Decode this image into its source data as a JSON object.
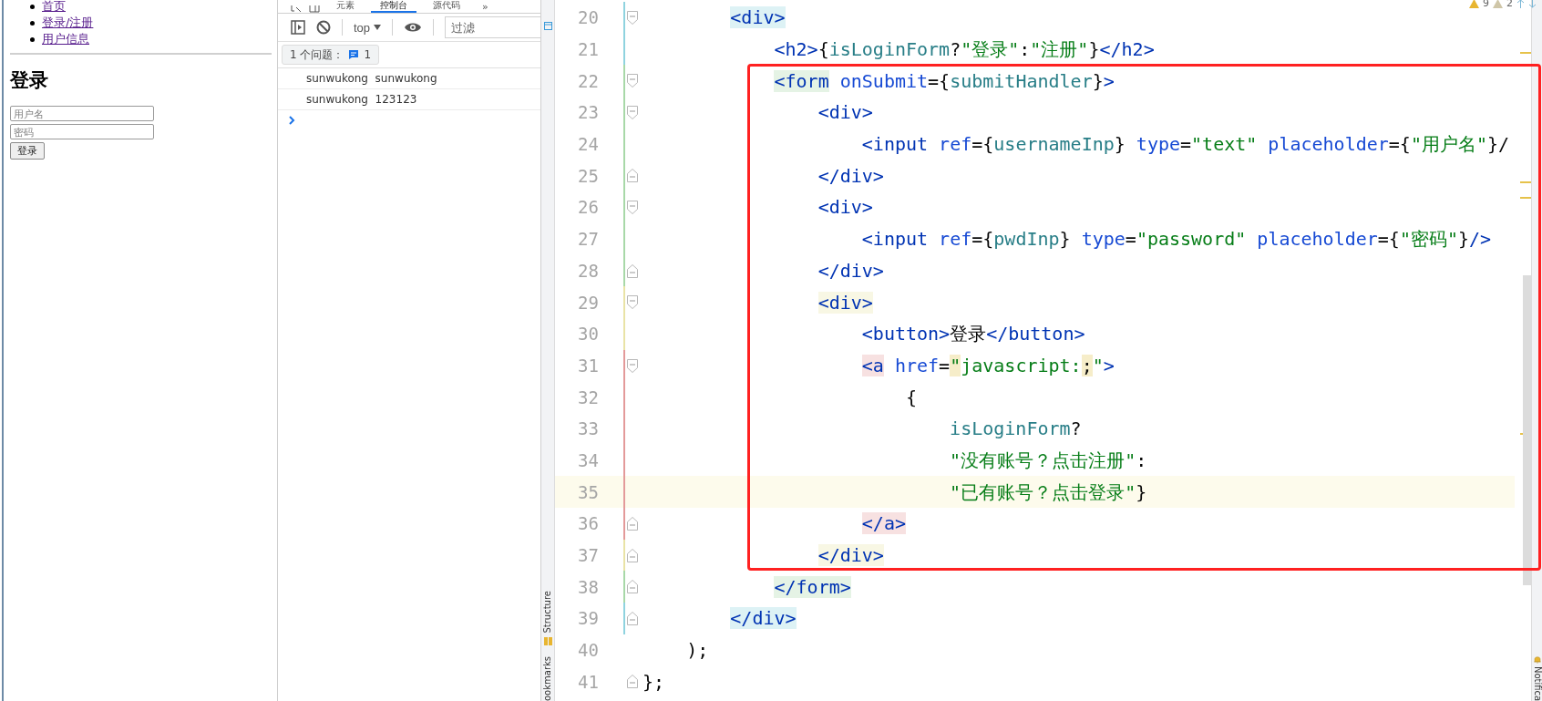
{
  "browser_page": {
    "nav_links": [
      {
        "label": "首页"
      },
      {
        "label": "登录/注册"
      },
      {
        "label": "用户信息"
      }
    ],
    "heading": "登录",
    "fields": [
      {
        "placeholder": "用户名"
      },
      {
        "placeholder": "密码"
      }
    ],
    "submit_button": "登录"
  },
  "devtools": {
    "tabs": [
      {
        "label": "元素",
        "selected": false
      },
      {
        "label": "控制台",
        "selected": true
      },
      {
        "label": "源代码",
        "selected": false
      }
    ],
    "more_tabs": "»",
    "context": "top",
    "filter": {
      "placeholder": "过滤"
    },
    "issues": {
      "label": "1 个问题：",
      "count": "1"
    },
    "console_messages": [
      "sunwukong  sunwukong",
      "sunwukong  123123"
    ]
  },
  "editor": {
    "inspections": {
      "warnings": "9",
      "weak_warnings": "2"
    },
    "left_tools": [
      "Structure",
      "ookmarks"
    ],
    "right_tools": [
      "Notifica"
    ],
    "lines": [
      {
        "number": "20",
        "fold_start": true,
        "fold_end": false,
        "color": "#8fd3df",
        "current": false,
        "tokens": [
          {
            "text": "        <div>",
            "kind": "tag",
            "matched": true
          }
        ]
      },
      {
        "number": "21",
        "fold_start": false,
        "fold_end": false,
        "color": "#8fd3df",
        "current": false,
        "tokens": [
          {
            "text": "            <h2>",
            "kind": "tag"
          },
          {
            "text": "{",
            "kind": "plain"
          },
          {
            "text": "isLoginForm",
            "kind": "ident"
          },
          {
            "text": "?",
            "kind": "plain"
          },
          {
            "text": "\"登录\"",
            "kind": "string"
          },
          {
            "text": ":",
            "kind": "plain"
          },
          {
            "text": "\"注册\"",
            "kind": "string"
          },
          {
            "text": "}",
            "kind": "plain"
          },
          {
            "text": "</h2>",
            "kind": "tag"
          }
        ]
      },
      {
        "number": "22",
        "fold_start": true,
        "fold_end": false,
        "color": "#a8d8a8",
        "current": false,
        "tokens": [
          {
            "text": "            <form",
            "kind": "tag",
            "matched": true
          },
          {
            "text": " onSubmit",
            "kind": "attr"
          },
          {
            "text": "={",
            "kind": "plain"
          },
          {
            "text": "submitHandler",
            "kind": "ident"
          },
          {
            "text": "}",
            "kind": "plain"
          },
          {
            "text": ">",
            "kind": "tag"
          }
        ]
      },
      {
        "number": "23",
        "fold_start": true,
        "fold_end": false,
        "color": "#a8d8a8",
        "current": false,
        "tokens": [
          {
            "text": "                <div>",
            "kind": "tag"
          }
        ]
      },
      {
        "number": "24",
        "fold_start": false,
        "fold_end": false,
        "color": "#a8d8a8",
        "current": false,
        "tokens": [
          {
            "text": "                    <input",
            "kind": "tag"
          },
          {
            "text": " ref",
            "kind": "attr"
          },
          {
            "text": "={",
            "kind": "plain"
          },
          {
            "text": "usernameInp",
            "kind": "ident"
          },
          {
            "text": "}",
            "kind": "plain"
          },
          {
            "text": " type",
            "kind": "attr"
          },
          {
            "text": "=",
            "kind": "plain"
          },
          {
            "text": "\"text\"",
            "kind": "string"
          },
          {
            "text": " placeholder",
            "kind": "attr"
          },
          {
            "text": "={",
            "kind": "plain"
          },
          {
            "text": "\"用户名\"",
            "kind": "string"
          },
          {
            "text": "}/",
            "kind": "plain"
          }
        ]
      },
      {
        "number": "25",
        "fold_start": false,
        "fold_end": true,
        "color": "#a8d8a8",
        "current": false,
        "tokens": [
          {
            "text": "                </div>",
            "kind": "tag"
          }
        ]
      },
      {
        "number": "26",
        "fold_start": true,
        "fold_end": false,
        "color": "#a8d8a8",
        "current": false,
        "tokens": [
          {
            "text": "                <div>",
            "kind": "tag"
          }
        ]
      },
      {
        "number": "27",
        "fold_start": false,
        "fold_end": false,
        "color": "#a8d8a8",
        "current": false,
        "tokens": [
          {
            "text": "                    <input",
            "kind": "tag"
          },
          {
            "text": " ref",
            "kind": "attr"
          },
          {
            "text": "={",
            "kind": "plain"
          },
          {
            "text": "pwdInp",
            "kind": "ident"
          },
          {
            "text": "}",
            "kind": "plain"
          },
          {
            "text": " type",
            "kind": "attr"
          },
          {
            "text": "=",
            "kind": "plain"
          },
          {
            "text": "\"password\"",
            "kind": "string"
          },
          {
            "text": " placeholder",
            "kind": "attr"
          },
          {
            "text": "={",
            "kind": "plain"
          },
          {
            "text": "\"密码\"",
            "kind": "string"
          },
          {
            "text": "}",
            "kind": "plain"
          },
          {
            "text": "/>",
            "kind": "tag"
          }
        ]
      },
      {
        "number": "28",
        "fold_start": false,
        "fold_end": true,
        "color": "#a8d8a8",
        "current": false,
        "tokens": [
          {
            "text": "                </div>",
            "kind": "tag"
          }
        ]
      },
      {
        "number": "29",
        "fold_start": true,
        "fold_end": false,
        "color": "#e9e3a6",
        "current": false,
        "tokens": [
          {
            "text": "                <div>",
            "kind": "tag",
            "matched": true
          }
        ]
      },
      {
        "number": "30",
        "fold_start": false,
        "fold_end": false,
        "color": "#e9e3a6",
        "current": false,
        "tokens": [
          {
            "text": "                    <button>",
            "kind": "tag"
          },
          {
            "text": "登录",
            "kind": "plain"
          },
          {
            "text": "</button>",
            "kind": "tag"
          }
        ]
      },
      {
        "number": "31",
        "fold_start": true,
        "fold_end": false,
        "color": "#e39a9a",
        "current": false,
        "tokens": [
          {
            "text": "                    <a",
            "kind": "tag",
            "matched": true
          },
          {
            "text": " href",
            "kind": "attr"
          },
          {
            "text": "=",
            "kind": "plain"
          },
          {
            "text": "\"",
            "kind": "string_paired"
          },
          {
            "text": "javascript:",
            "kind": "string"
          },
          {
            "text": ";",
            "kind": "plain_paired"
          },
          {
            "text": "\"",
            "kind": "string"
          },
          {
            "text": ">",
            "kind": "tag"
          }
        ]
      },
      {
        "number": "32",
        "fold_start": false,
        "fold_end": false,
        "color": "#e39a9a",
        "current": false,
        "tokens": [
          {
            "text": "                        {",
            "kind": "plain"
          }
        ]
      },
      {
        "number": "33",
        "fold_start": false,
        "fold_end": false,
        "color": "#e39a9a",
        "current": false,
        "tokens": [
          {
            "text": "                            isLoginForm",
            "kind": "ident"
          },
          {
            "text": "?",
            "kind": "plain"
          }
        ]
      },
      {
        "number": "34",
        "fold_start": false,
        "fold_end": false,
        "color": "#e39a9a",
        "current": false,
        "tokens": [
          {
            "text": "                            \"没有账号？点击注册\"",
            "kind": "string"
          },
          {
            "text": ":",
            "kind": "plain"
          }
        ]
      },
      {
        "number": "35",
        "fold_start": false,
        "fold_end": false,
        "color": "#e39a9a",
        "current": true,
        "tokens": [
          {
            "text": "                            \"已有账号？点击登录\"",
            "kind": "string"
          },
          {
            "text": "}",
            "kind": "plain"
          }
        ]
      },
      {
        "number": "36",
        "fold_start": false,
        "fold_end": true,
        "color": "#e39a9a",
        "current": false,
        "tokens": [
          {
            "text": "                    </a>",
            "kind": "tag",
            "matched": true
          }
        ]
      },
      {
        "number": "37",
        "fold_start": false,
        "fold_end": true,
        "color": "#e9e3a6",
        "current": false,
        "tokens": [
          {
            "text": "                </div>",
            "kind": "tag",
            "matched": true
          }
        ]
      },
      {
        "number": "38",
        "fold_start": false,
        "fold_end": true,
        "color": "#a8d8a8",
        "current": false,
        "tokens": [
          {
            "text": "            </form>",
            "kind": "tag",
            "matched": true
          }
        ]
      },
      {
        "number": "39",
        "fold_start": false,
        "fold_end": true,
        "color": "#8fd3df",
        "current": false,
        "tokens": [
          {
            "text": "        </div>",
            "kind": "tag",
            "matched": true
          }
        ]
      },
      {
        "number": "40",
        "fold_start": false,
        "fold_end": false,
        "current": false,
        "tokens": [
          {
            "text": "    );",
            "kind": "plain"
          }
        ]
      },
      {
        "number": "41",
        "fold_start": false,
        "fold_end": true,
        "current": false,
        "tokens": [
          {
            "text": "};",
            "kind": "plain"
          }
        ]
      }
    ]
  }
}
